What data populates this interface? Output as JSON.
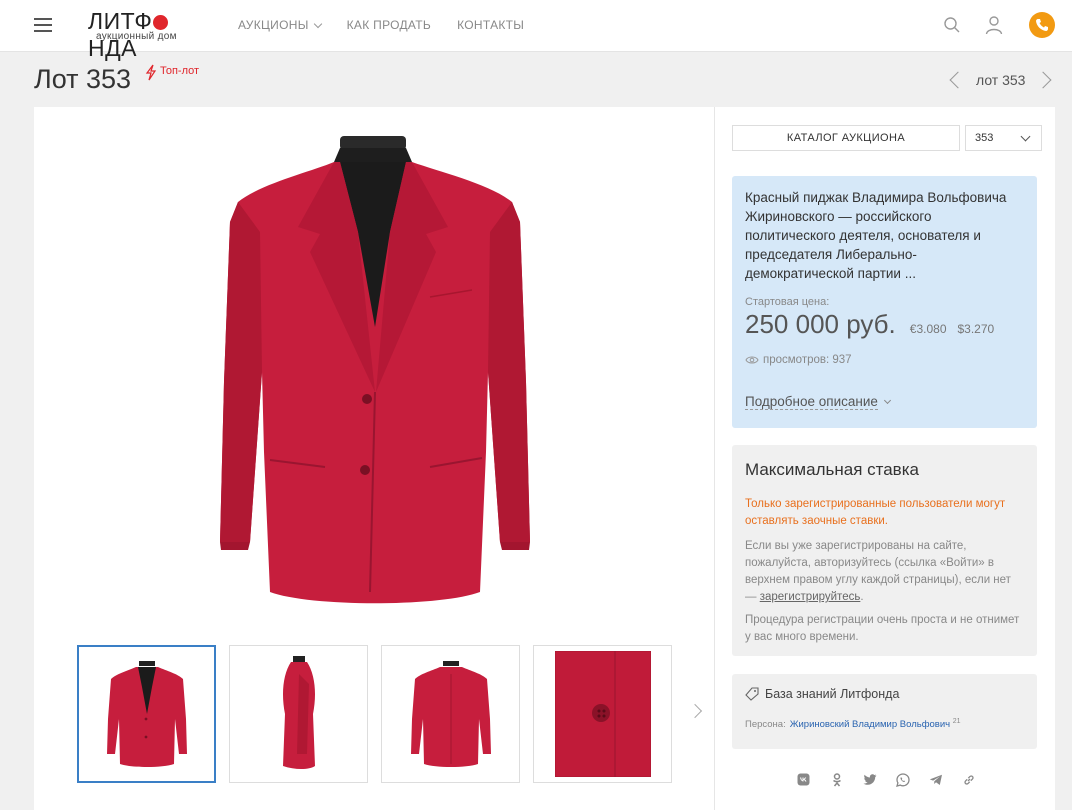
{
  "header": {
    "logo_main_left": "ЛИТФ",
    "logo_main_right": "НДА",
    "logo_sub": "аукционный дом",
    "nav": [
      {
        "label": "АУКЦИОНЫ",
        "has_dropdown": true
      },
      {
        "label": "КАК ПРОДАТЬ"
      },
      {
        "label": "КОНТАКТЫ"
      }
    ],
    "icons": [
      "menu-icon",
      "search-icon",
      "user-icon",
      "phone-icon"
    ],
    "accent_color": "#f29a12"
  },
  "lot": {
    "title": "Лот 353",
    "badge": "Топ-лот",
    "nav_label": "лот 353"
  },
  "sidebar": {
    "catalog_button": "КАТАЛОГ АУКЦИОНА",
    "lot_select_value": "353",
    "description": "Красный пиджак Владимира Вольфовича Жириновского — российского политического деятеля, основателя и председателя Либерально-демократической партии ...",
    "start_price_label": "Стартовая цена:",
    "start_price": "250 000 руб.",
    "price_eur": "€3.080",
    "price_usd": "$3.270",
    "views": "просмотров: 937",
    "more_link": "Подробное описание"
  },
  "bid": {
    "title": "Максимальная ставка",
    "warning": "Только зарегистрированные пользователи могут оставлять заочные ставки.",
    "text_before_link": "Если вы уже зарегистрированы на сайте, пожалуйста, авторизуйтесь (ссылка «Войти» в верхнем правом углу каждой страницы), если нет — ",
    "register_link": "зарегистрируйтесь",
    "text_after_link": ".",
    "note": "Процедура регистрации очень проста и не отнимет у вас много времени."
  },
  "knowledge": {
    "title": "База знаний Литфонда",
    "person_label": "Персона:",
    "person_name": "Жириновский Владимир Вольфович",
    "person_count": "21"
  },
  "gallery": {
    "thumbnails": [
      "front",
      "side",
      "back",
      "button-detail"
    ],
    "active_index": 0
  },
  "share_icons": [
    "vk-icon",
    "odnoklassniki-icon",
    "twitter-icon",
    "whatsapp-icon",
    "telegram-icon",
    "link-icon"
  ]
}
